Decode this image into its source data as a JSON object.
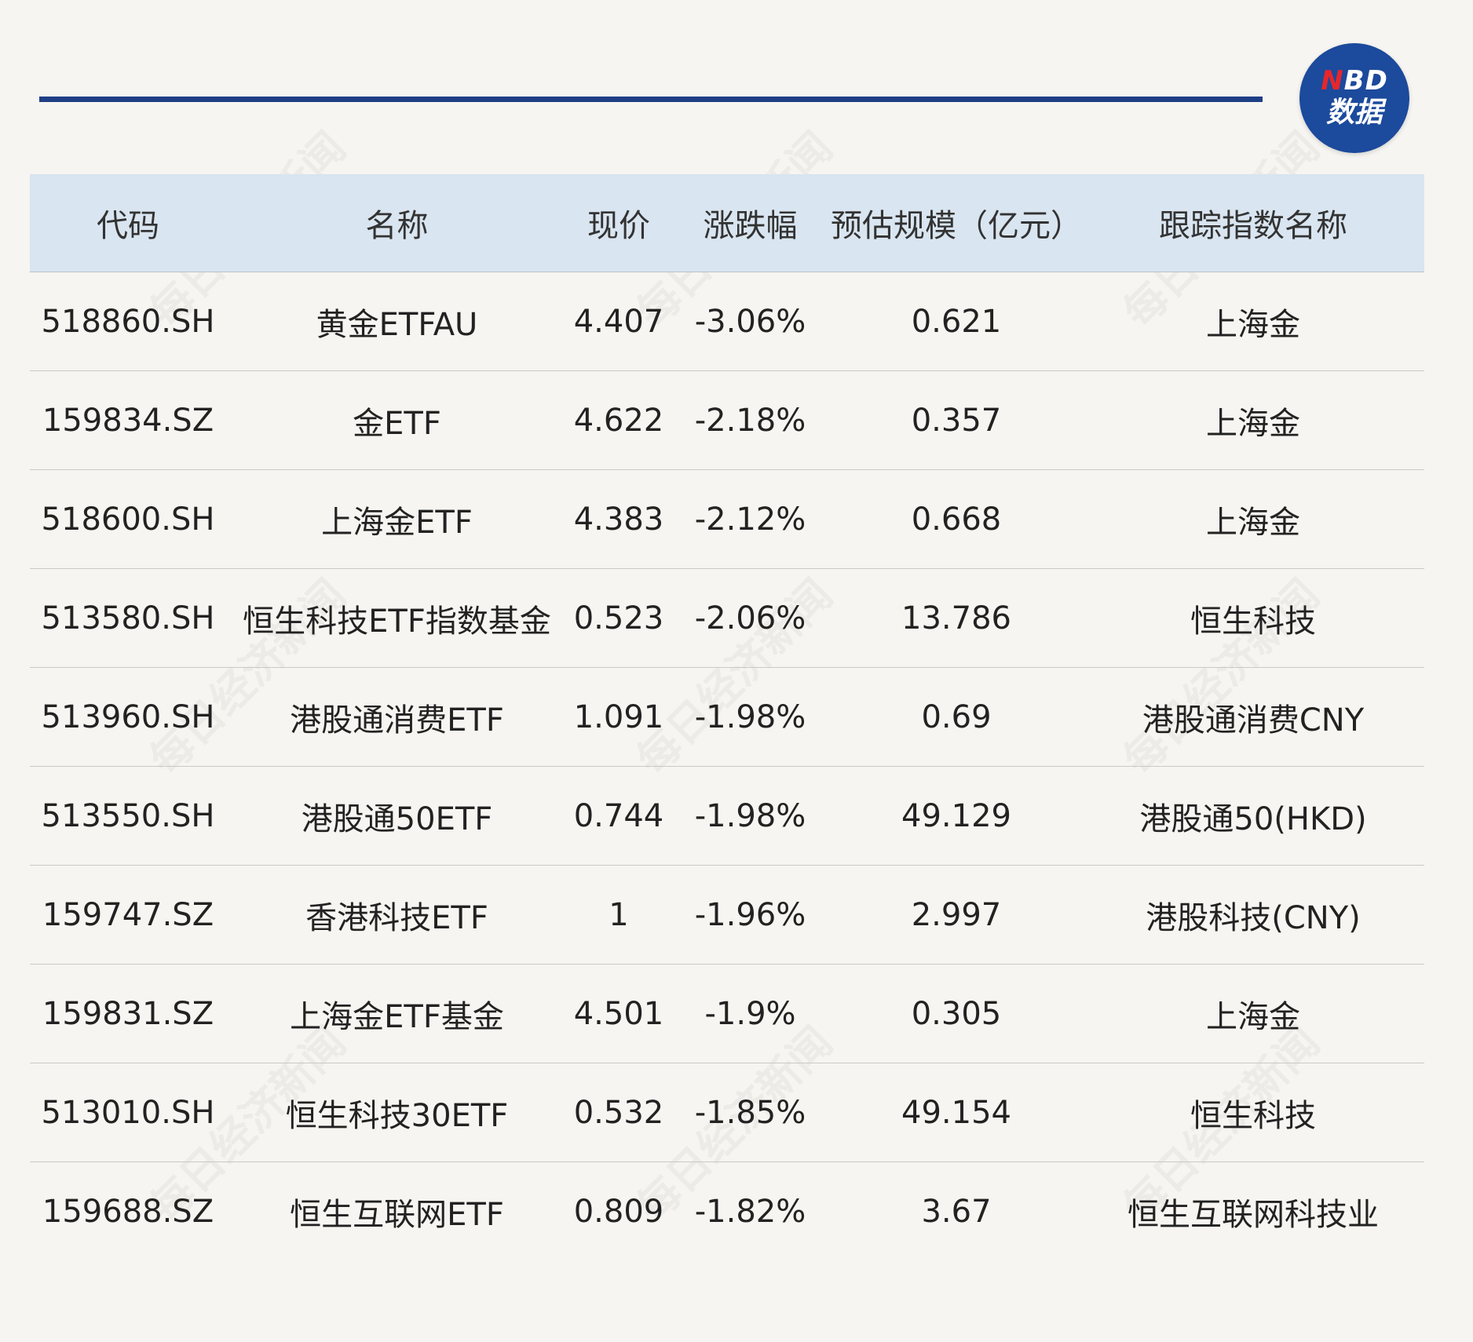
{
  "brand": {
    "logo_top_n": "N",
    "logo_top_rest": "BD",
    "logo_bottom": "数据",
    "colors": {
      "accent": "#1f3f86",
      "logo_bg": "#1c4a9c",
      "logo_red": "#e8262a",
      "header_bg": "#d9e5f0"
    }
  },
  "watermark_text": "每日经济新闻",
  "table": {
    "headers": [
      "代码",
      "名称",
      "现价",
      "涨跌幅",
      "预估规模（亿元）",
      "跟踪指数名称"
    ],
    "rows": [
      [
        "518860.SH",
        "黄金ETFAU",
        "4.407",
        "-3.06%",
        "0.621",
        "上海金"
      ],
      [
        "159834.SZ",
        "金ETF",
        "4.622",
        "-2.18%",
        "0.357",
        "上海金"
      ],
      [
        "518600.SH",
        "上海金ETF",
        "4.383",
        "-2.12%",
        "0.668",
        "上海金"
      ],
      [
        "513580.SH",
        "恒生科技ETF指数基金",
        "0.523",
        "-2.06%",
        "13.786",
        "恒生科技"
      ],
      [
        "513960.SH",
        "港股通消费ETF",
        "1.091",
        "-1.98%",
        "0.69",
        "港股通消费CNY"
      ],
      [
        "513550.SH",
        "港股通50ETF",
        "0.744",
        "-1.98%",
        "49.129",
        "港股通50(HKD)"
      ],
      [
        "159747.SZ",
        "香港科技ETF",
        "1",
        "-1.96%",
        "2.997",
        "港股科技(CNY)"
      ],
      [
        "159831.SZ",
        "上海金ETF基金",
        "4.501",
        "-1.9%",
        "0.305",
        "上海金"
      ],
      [
        "513010.SH",
        "恒生科技30ETF",
        "0.532",
        "-1.85%",
        "49.154",
        "恒生科技"
      ],
      [
        "159688.SZ",
        "恒生互联网ETF",
        "0.809",
        "-1.82%",
        "3.67",
        "恒生互联网科技业"
      ]
    ]
  }
}
